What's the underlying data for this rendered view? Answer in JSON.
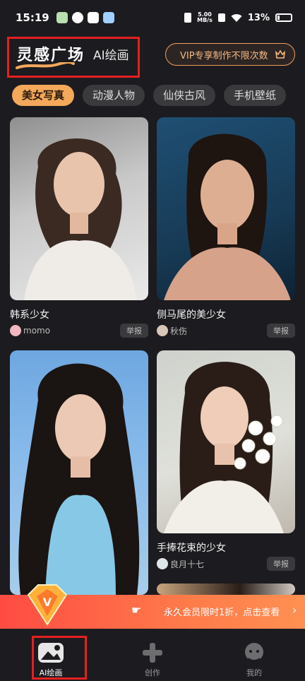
{
  "status": {
    "time": "15:19",
    "net_speed_top": "5.00",
    "net_speed_bottom": "MB/s",
    "battery": "13%"
  },
  "header": {
    "tab_main": "灵感广场",
    "tab_sub": "AI绘画",
    "vip_label": "VIP专享制作不限次数"
  },
  "categories": [
    "美女写真",
    "动漫人物",
    "仙侠古风",
    "手机壁纸"
  ],
  "cards": [
    {
      "title": "韩系少女",
      "author": "momo",
      "report": "举报"
    },
    {
      "title": "侧马尾的美少女",
      "author": "秋伤",
      "report": "举报"
    },
    {
      "title": "",
      "author": "",
      "report": ""
    },
    {
      "title": "手捧花束的少女",
      "author": "良月十七",
      "report": "举报"
    }
  ],
  "promo": {
    "text": "永久会员限时1折，点击查看",
    "chevron": "›"
  },
  "nav": [
    {
      "label": "AI绘画",
      "icon": "image-mountain-icon"
    },
    {
      "label": "创作",
      "icon": "plus-icon"
    },
    {
      "label": "我的",
      "icon": "profile-icon"
    }
  ],
  "colors": {
    "accent": "#f3a85a",
    "background": "#1c1b1f",
    "promo": "#ff5a45",
    "highlight_box": "#e52020"
  }
}
